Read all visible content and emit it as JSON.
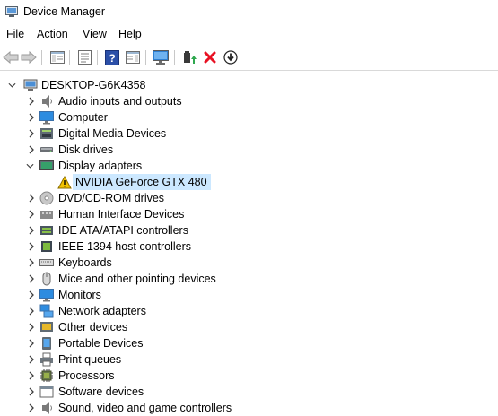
{
  "window": {
    "title": "Device Manager"
  },
  "menu": {
    "items": [
      "File",
      "Action",
      "View",
      "Help"
    ]
  },
  "toolbar": {
    "buttons": [
      "back-icon",
      "forward-icon",
      "show-hide-tree-icon",
      "properties-icon",
      "help-icon",
      "action-view-icon",
      "monitor-scan-icon",
      "update-driver-icon",
      "uninstall-icon",
      "download-icon"
    ]
  },
  "tree": {
    "root": {
      "label": "DESKTOP-G6K4358",
      "expanded": true
    },
    "categories": [
      {
        "label": "Audio inputs and outputs",
        "icon": "speaker-icon",
        "expanded": false
      },
      {
        "label": "Computer",
        "icon": "computer-icon",
        "expanded": false
      },
      {
        "label": "Digital Media Devices",
        "icon": "media-device-icon",
        "expanded": false
      },
      {
        "label": "Disk drives",
        "icon": "disk-drive-icon",
        "expanded": false
      },
      {
        "label": "Display adapters",
        "icon": "display-adapter-icon",
        "expanded": true,
        "children": [
          {
            "label": "NVIDIA GeForce GTX 480",
            "icon": "warning-icon",
            "selected": true
          }
        ]
      },
      {
        "label": "DVD/CD-ROM drives",
        "icon": "dvd-icon",
        "expanded": false
      },
      {
        "label": "Human Interface Devices",
        "icon": "hid-icon",
        "expanded": false
      },
      {
        "label": "IDE ATA/ATAPI controllers",
        "icon": "ide-controller-icon",
        "expanded": false
      },
      {
        "label": "IEEE 1394 host controllers",
        "icon": "ieee1394-icon",
        "expanded": false
      },
      {
        "label": "Keyboards",
        "icon": "keyboard-icon",
        "expanded": false
      },
      {
        "label": "Mice and other pointing devices",
        "icon": "mouse-icon",
        "expanded": false
      },
      {
        "label": "Monitors",
        "icon": "monitor-icon",
        "expanded": false
      },
      {
        "label": "Network adapters",
        "icon": "network-adapter-icon",
        "expanded": false
      },
      {
        "label": "Other devices",
        "icon": "other-devices-icon",
        "expanded": false
      },
      {
        "label": "Portable Devices",
        "icon": "portable-device-icon",
        "expanded": false
      },
      {
        "label": "Print queues",
        "icon": "printer-icon",
        "expanded": false
      },
      {
        "label": "Processors",
        "icon": "processor-icon",
        "expanded": false
      },
      {
        "label": "Software devices",
        "icon": "software-device-icon",
        "expanded": false
      },
      {
        "label": "Sound, video and game controllers",
        "icon": "sound-controller-icon",
        "expanded": false
      }
    ]
  },
  "colors": {
    "selection": "#cce8ff",
    "accent": "#0078d7",
    "uninstall": "#e81123",
    "warning": "#f2c200"
  }
}
